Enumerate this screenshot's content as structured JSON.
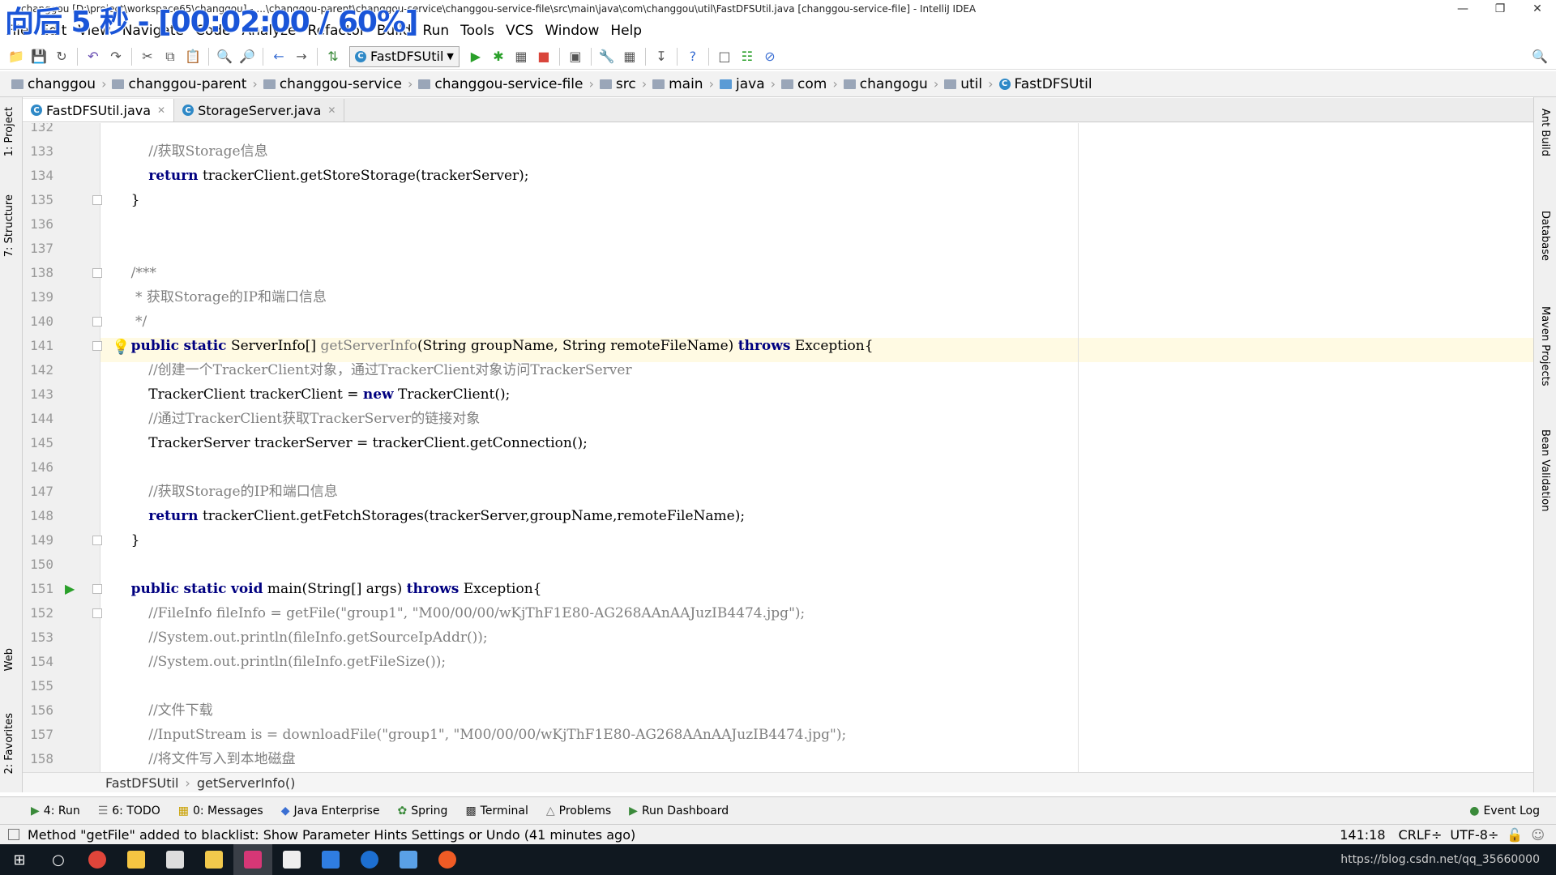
{
  "overlay_text": "向后 5 秒 - [00:02:00 / 60%]",
  "window_title": "changgou [D:\\project\\workspace65\\changgou] - ...\\changgou-parent\\changgou-service\\changgou-service-file\\src\\main\\java\\com\\changgou\\util\\FastDFSUtil.java [changgou-service-file] - IntelliJ IDEA",
  "menu": [
    "File",
    "Edit",
    "View",
    "Navigate",
    "Code",
    "Analyze",
    "Refactor",
    "Build",
    "Run",
    "Tools",
    "VCS",
    "Window",
    "Help"
  ],
  "toolbar": {
    "run_config": "FastDFSUtil"
  },
  "breadcrumb": [
    "changgou",
    "changgou-parent",
    "changgou-service",
    "changgou-service-file",
    "src",
    "main",
    "java",
    "com",
    "changogu",
    "util",
    "FastDFSUtil"
  ],
  "tabs": [
    {
      "label": "FastDFSUtil.java",
      "active": true
    },
    {
      "label": "StorageServer.java",
      "active": false
    }
  ],
  "left_tools": [
    "1: Project",
    "7: Structure",
    "Web",
    "2: Favorites"
  ],
  "right_tools": [
    "Ant Build",
    "Database",
    "Maven Projects",
    "Bean Validation"
  ],
  "code_lines": [
    {
      "n": "132",
      "t": ""
    },
    {
      "n": "133",
      "t": "        //获取Storage信息"
    },
    {
      "n": "134",
      "t": "        return trackerClient.getStoreStorage(trackerServer);"
    },
    {
      "n": "135",
      "t": "    }"
    },
    {
      "n": "136",
      "t": ""
    },
    {
      "n": "137",
      "t": ""
    },
    {
      "n": "138",
      "t": "    /***"
    },
    {
      "n": "139",
      "t": "     * 获取Storage的IP和端口信息"
    },
    {
      "n": "140",
      "t": "     */"
    },
    {
      "n": "141",
      "t": "    public static ServerInfo[] getServerInfo(String groupName, String remoteFileName) throws Exception{"
    },
    {
      "n": "142",
      "t": "        //创建一个TrackerClient对象，通过TrackerClient对象访问TrackerServer"
    },
    {
      "n": "143",
      "t": "        TrackerClient trackerClient = new TrackerClient();"
    },
    {
      "n": "144",
      "t": "        //通过TrackerClient获取TrackerServer的链接对象"
    },
    {
      "n": "145",
      "t": "        TrackerServer trackerServer = trackerClient.getConnection();"
    },
    {
      "n": "146",
      "t": ""
    },
    {
      "n": "147",
      "t": "        //获取Storage的IP和端口信息"
    },
    {
      "n": "148",
      "t": "        return trackerClient.getFetchStorages(trackerServer,groupName,remoteFileName);"
    },
    {
      "n": "149",
      "t": "    }"
    },
    {
      "n": "150",
      "t": ""
    },
    {
      "n": "151",
      "t": "    public static void main(String[] args) throws Exception{"
    },
    {
      "n": "152",
      "t": "        //FileInfo fileInfo = getFile(\"group1\", \"M00/00/00/wKjThF1E80-AG268AAnAAJuzIB4474.jpg\");"
    },
    {
      "n": "153",
      "t": "        //System.out.println(fileInfo.getSourceIpAddr());"
    },
    {
      "n": "154",
      "t": "        //System.out.println(fileInfo.getFileSize());"
    },
    {
      "n": "155",
      "t": ""
    },
    {
      "n": "156",
      "t": "        //文件下载"
    },
    {
      "n": "157",
      "t": "        //InputStream is = downloadFile(\"group1\", \"M00/00/00/wKjThF1E80-AG268AAnAAJuzIB4474.jpg\");"
    },
    {
      "n": "158",
      "t": "        //将文件写入到本地磁盘"
    }
  ],
  "editor_breadcrumb": [
    "FastDFSUtil",
    "getServerInfo()"
  ],
  "tool_windows": [
    "4: Run",
    "6: TODO",
    "0: Messages",
    "Java Enterprise",
    "Spring",
    "Terminal",
    "Problems",
    "Run Dashboard"
  ],
  "event_log": "Event Log",
  "status_message": "Method \"getFile\" added to blacklist: Show Parameter Hints Settings or Undo (41 minutes ago)",
  "status_right": {
    "position": "141:18",
    "line_sep": "CRLF÷",
    "encoding": "UTF-8÷"
  },
  "tray_text": "https://blog.csdn.net/qq_35660000"
}
